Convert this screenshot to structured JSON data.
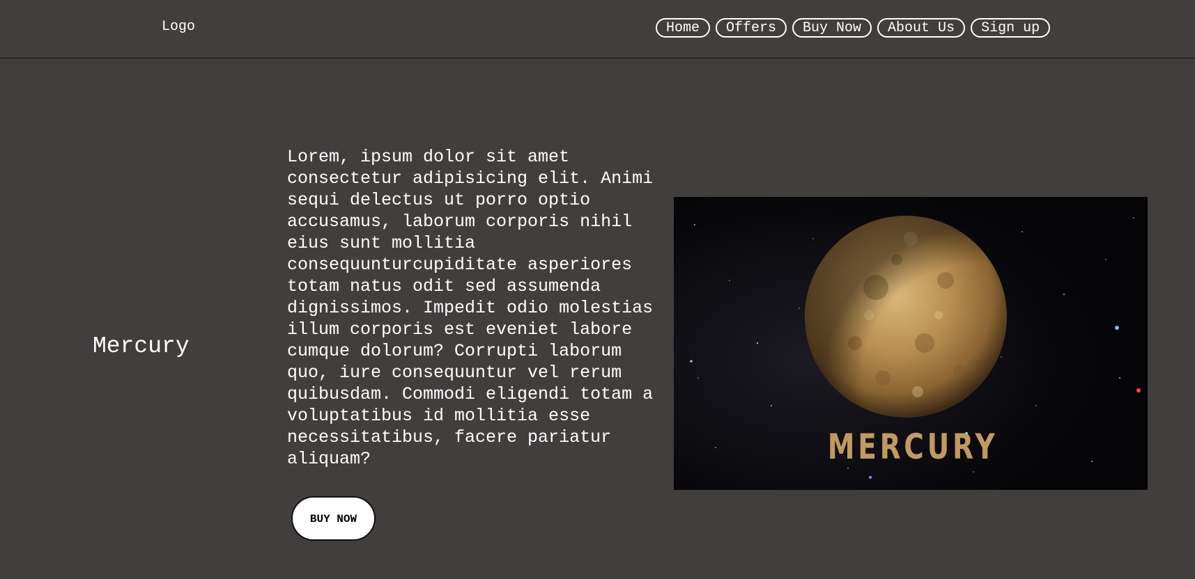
{
  "header": {
    "logo": "Logo",
    "nav": [
      {
        "label": "Home"
      },
      {
        "label": "Offers"
      },
      {
        "label": "Buy Now"
      },
      {
        "label": "About Us"
      },
      {
        "label": "Sign up"
      }
    ]
  },
  "main": {
    "planet_name": "Mercury",
    "description": "Lorem, ipsum dolor sit amet consectetur adipisicing elit. Animi sequi delectus ut porro optio accusamus, laborum corporis nihil eius sunt mollitia consequunturcupiditate asperiores totam natus odit sed assumenda dignissimos. Impedit odio molestias illum corporis est eveniet labore cumque dolorum? Corrupti laborum quo, iure consequuntur vel rerum quibusdam. Commodi eligendi totam a voluptatibus id mollitia esse necessitatibus, facere pariatur aliquam?",
    "buy_button": "BUY NOW",
    "image": {
      "caption": "MERCURY",
      "icon": "mercury-planet-image",
      "caption_color": "#c19a5e"
    }
  },
  "colors": {
    "background": "#423e3d",
    "text": "#ffffff",
    "button_bg": "#ffffff"
  }
}
